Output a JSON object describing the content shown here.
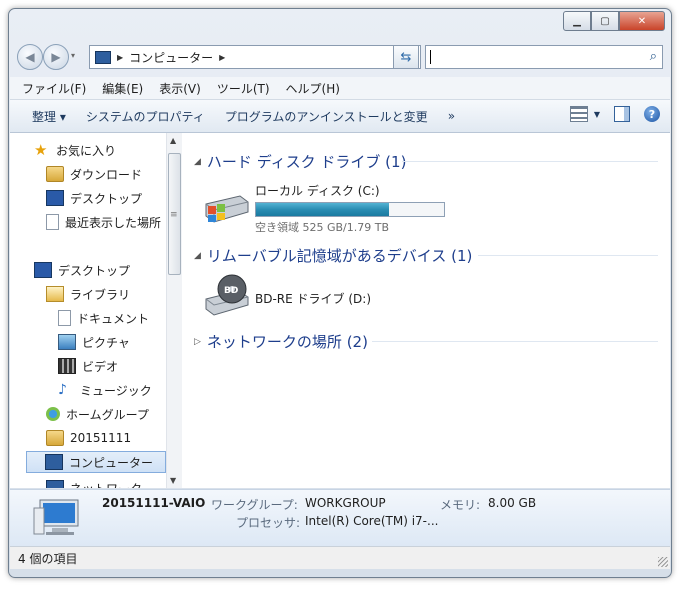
{
  "window": {
    "minimize_icon": "minimize-icon",
    "maximize_icon": "maximize-icon",
    "close_icon": "close-icon"
  },
  "address": {
    "path": "コンピューター"
  },
  "search": {
    "placeholder": ""
  },
  "menu": [
    "ファイル(F)",
    "編集(E)",
    "表示(V)",
    "ツール(T)",
    "ヘルプ(H)"
  ],
  "toolbar": {
    "organize": "整理 ▾",
    "system_properties": "システムのプロパティ",
    "uninstall": "プログラムのアンインストールと変更",
    "more": "»"
  },
  "sidebar": {
    "items": [
      {
        "label": "お気に入り",
        "icon": "star-icon"
      },
      {
        "label": "ダウンロード",
        "icon": "downloads-folder-icon"
      },
      {
        "label": "デスクトップ",
        "icon": "desktop-icon"
      },
      {
        "label": "最近表示した場所",
        "icon": "recent-places-icon"
      },
      {
        "label": "デスクトップ",
        "icon": "desktop-icon"
      },
      {
        "label": "ライブラリ",
        "icon": "libraries-icon"
      },
      {
        "label": "ドキュメント",
        "icon": "documents-icon"
      },
      {
        "label": "ピクチャ",
        "icon": "pictures-icon"
      },
      {
        "label": "ビデオ",
        "icon": "videos-icon"
      },
      {
        "label": "ミュージック",
        "icon": "music-icon"
      },
      {
        "label": "ホームグループ",
        "icon": "homegroup-icon"
      },
      {
        "label": "20151111",
        "icon": "user-folder-icon"
      },
      {
        "label": "コンピューター",
        "icon": "computer-icon"
      },
      {
        "label": "ネットワーク",
        "icon": "network-icon"
      }
    ]
  },
  "groups": {
    "hdd": {
      "title": "ハード ディスク ドライブ (1)"
    },
    "removable": {
      "title": "リムーバブル記憶域があるデバイス (1)"
    },
    "network": {
      "title": "ネットワークの場所 (2)"
    }
  },
  "drives": {
    "c": {
      "label": "ローカル ディスク (C:)",
      "space": "空き領域 525 GB/1.79 TB",
      "used_fraction": 0.71
    },
    "d": {
      "label": "BD-RE ドライブ (D:)"
    }
  },
  "details": {
    "name": "20151111-VAIO",
    "workgroup_label": "ワークグループ:",
    "workgroup": "WORKGROUP",
    "memory_label": "メモリ:",
    "memory": "8.00 GB",
    "processor_label": "プロセッサ:",
    "processor": "Intel(R) Core(TM) i7-..."
  },
  "status": {
    "count": "4 個の項目"
  },
  "colors": {
    "accent": "#1e3e8c",
    "bar_fill": "#2a8db3"
  }
}
